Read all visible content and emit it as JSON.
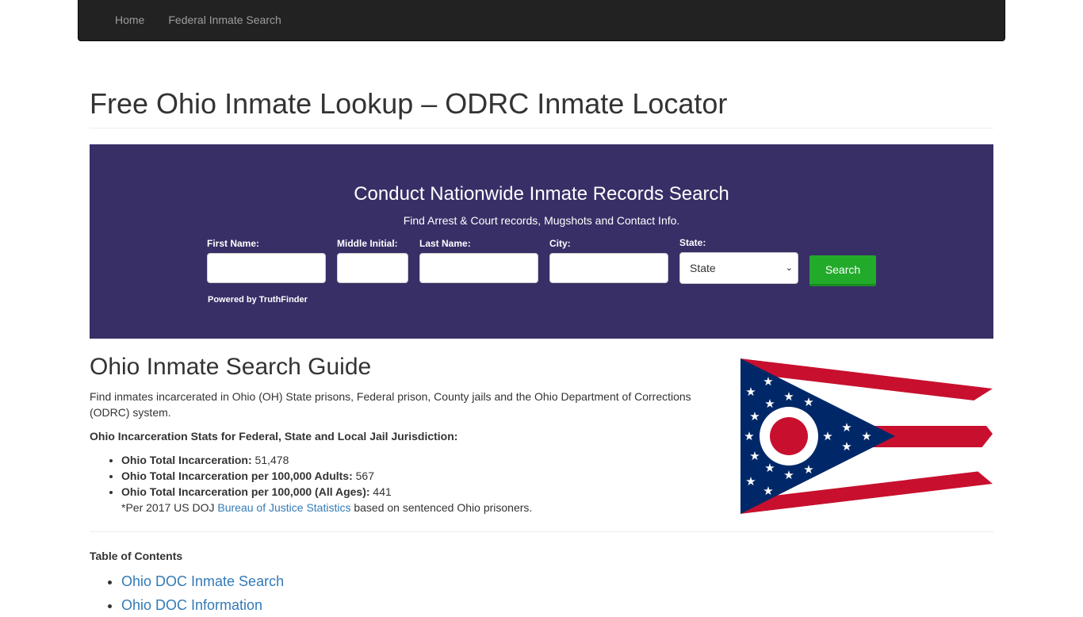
{
  "nav": {
    "items": [
      {
        "label": "Home"
      },
      {
        "label": "Federal Inmate Search"
      }
    ]
  },
  "page_title": "Free Ohio Inmate Lookup – ODRC Inmate Locator",
  "search_banner": {
    "heading": "Conduct Nationwide Inmate Records Search",
    "subheading": "Find Arrest & Court records, Mugshots and Contact Info.",
    "fields": {
      "first_name": {
        "label": "First Name:",
        "value": ""
      },
      "middle_initial": {
        "label": "Middle Initial:",
        "value": ""
      },
      "last_name": {
        "label": "Last Name:",
        "value": ""
      },
      "city": {
        "label": "City:",
        "value": ""
      },
      "state": {
        "label": "State:",
        "selected": "State"
      }
    },
    "search_label": "Search",
    "powered_by": "Powered by TruthFinder",
    "colors": {
      "background": "#372f66",
      "button": "#22aa2b"
    }
  },
  "guide": {
    "title": "Ohio Inmate Search Guide",
    "intro": "Find inmates incarcerated in Ohio (OH) State prisons, Federal prison, County jails and the Ohio Department of Corrections (ODRC) system.",
    "stats_heading": "Ohio Incarceration Stats for Federal, State and Local Jail Jurisdiction:",
    "stats": [
      {
        "label": "Ohio Total Incarceration:",
        "value": "51,478"
      },
      {
        "label": "Ohio Total Incarceration per 100,000 Adults:",
        "value": "567"
      },
      {
        "label": "Ohio Total Incarceration per 100,000 (All Ages):",
        "value": "441"
      }
    ],
    "note_prefix": "*Per 2017 US DOJ ",
    "note_link": "Bureau of Justice Statistics",
    "note_suffix": " based on sentenced Ohio prisoners.",
    "flag_icon": "ohio-flag"
  },
  "toc": {
    "heading": "Table of Contents",
    "items": [
      {
        "label": "Ohio DOC Inmate Search"
      },
      {
        "label": "Ohio DOC Information"
      }
    ]
  }
}
